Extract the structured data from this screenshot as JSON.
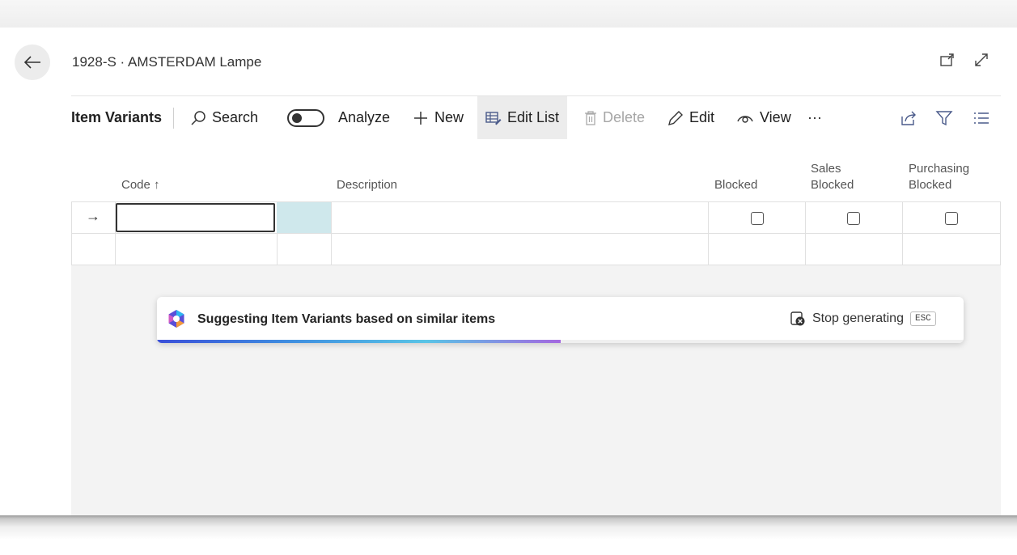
{
  "page": {
    "title": "1928-S · AMSTERDAM Lampe"
  },
  "toolbar": {
    "tab_label": "Item Variants",
    "search_label": "Search",
    "analyze_label": "Analyze",
    "new_label": "New",
    "edit_list_label": "Edit List",
    "delete_label": "Delete",
    "edit_label": "Edit",
    "view_label": "View",
    "more_label": "···"
  },
  "grid": {
    "columns": {
      "code": "Code ↑",
      "description": "Description",
      "blocked": "Blocked",
      "sales_blocked_1": "Sales",
      "sales_blocked_2": "Blocked",
      "purchasing_blocked_1": "Purchasing",
      "purchasing_blocked_2": "Blocked"
    },
    "row_indicator": "→"
  },
  "copilot": {
    "message": "Suggesting Item Variants based on similar items",
    "stop_label": "Stop generating",
    "shortcut": "ESC",
    "progress": 0.5
  },
  "colors": {
    "accent_bar_start": "#3a4fd9",
    "accent_bar_end": "#a468e0",
    "selected_cell_tint": "#cfe8ec"
  },
  "icons": [
    "back-arrow-icon",
    "open-new-window-icon",
    "expand-icon",
    "search-icon",
    "plus-icon",
    "edit-list-icon",
    "trash-icon",
    "pencil-icon",
    "eye-icon",
    "share-icon",
    "filter-icon",
    "list-icon",
    "copilot-icon",
    "stop-icon"
  ]
}
